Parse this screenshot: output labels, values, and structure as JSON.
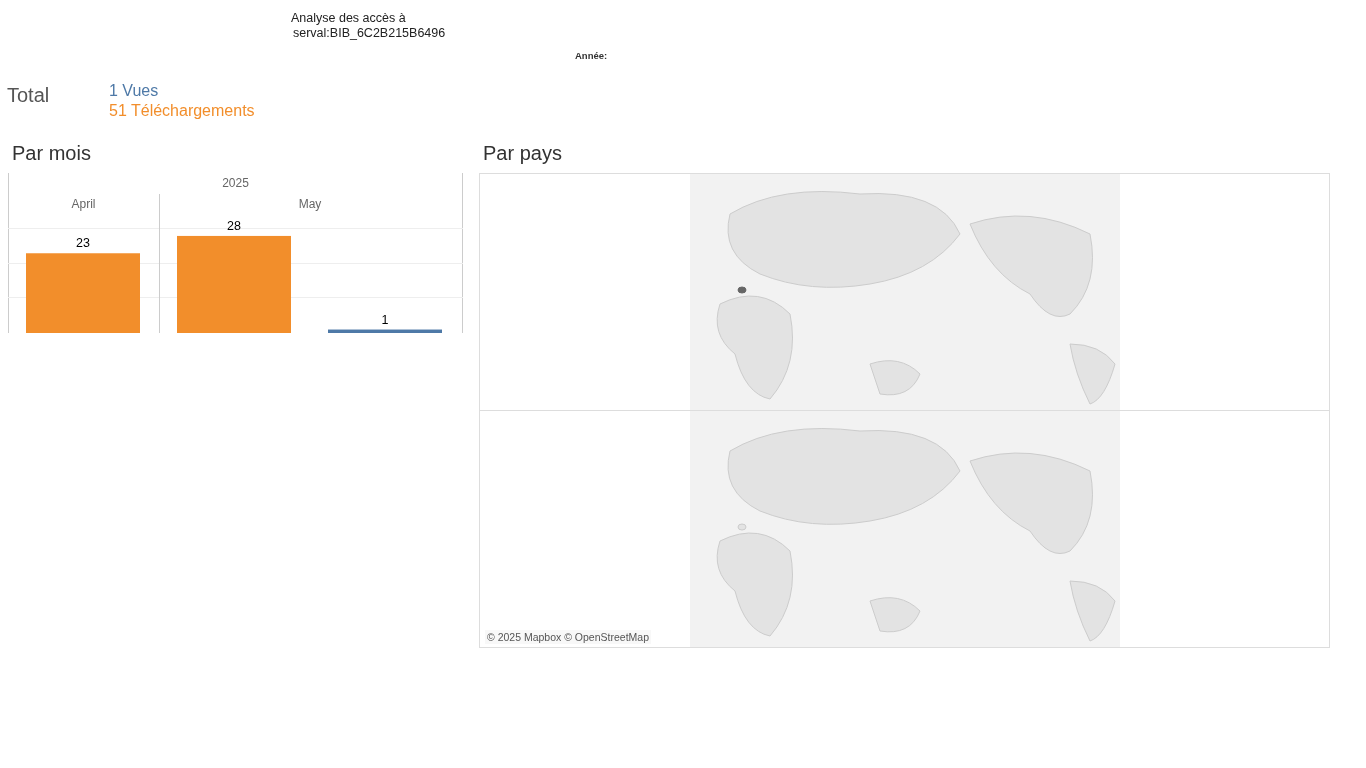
{
  "header": {
    "title": "Analyse des accès à",
    "subtitle": "serval:BIB_6C2B215B6496",
    "filter_label": "Année:"
  },
  "total": {
    "label": "Total",
    "views": "1 Vues",
    "downloads": "51 Téléchargements"
  },
  "by_month": {
    "title": "Par mois",
    "year_header": "2025",
    "chart_data": {
      "type": "bar",
      "categories": [
        "April",
        "May"
      ],
      "series": [
        {
          "color": "#f28e2b",
          "values": [
            23,
            28
          ]
        },
        {
          "color": "#4e79a7",
          "values": [
            null,
            1
          ]
        }
      ],
      "data_labels": true
    }
  },
  "by_country": {
    "title": "Par pays",
    "maps": [
      {
        "highlighted": true
      },
      {
        "highlighted": false
      }
    ],
    "attribution": "© 2025 Mapbox © OpenStreetMap"
  }
}
